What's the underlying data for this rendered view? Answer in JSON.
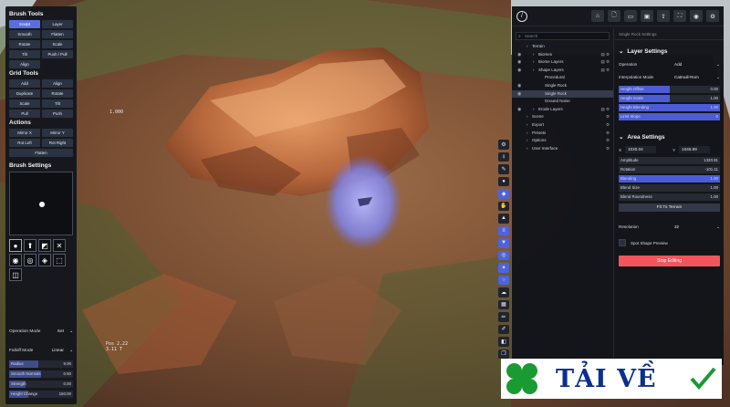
{
  "left_panel": {
    "brush_tools": {
      "title": "Brush Tools",
      "buttons": [
        "Sculpt",
        "Layer",
        "Smooth",
        "Flatten",
        "Rotate",
        "Scale",
        "Tilt",
        "Push / Pull",
        "Align"
      ]
    },
    "grid_tools": {
      "title": "Grid Tools",
      "buttons": [
        "Add",
        "Align",
        "Duplicate",
        "Rotate",
        "Scale",
        "Tilt",
        "Pull",
        "Push"
      ]
    },
    "actions": {
      "title": "Actions",
      "buttons": [
        "Mirror X",
        "Mirror Y",
        "Rot Left",
        "Rot Right",
        "Flatten"
      ]
    },
    "brush_settings": {
      "title": "Brush Settings",
      "brush_icons": [
        "●",
        "⬆",
        "◩",
        "✕",
        "◉",
        "◎",
        "◈",
        "⬚",
        "◫"
      ],
      "operation_mode": {
        "label": "Operation Mode",
        "value": "Set"
      },
      "falloff_mode": {
        "label": "Falloff Mode",
        "value": "Linear"
      },
      "sliders": [
        {
          "label": "Radius",
          "value": "9.00",
          "level": 0.45
        },
        {
          "label": "Smooth Normals",
          "value": "0.50",
          "level": 0.5
        },
        {
          "label": "Strength",
          "value": "0.00",
          "level": 0.25
        },
        {
          "label": "Height Change",
          "value": "150.00",
          "level": 0.3
        }
      ]
    }
  },
  "viewport": {
    "scale_label": "1.000",
    "coords_label": "Pos 2.22\n3.11 T"
  },
  "right_panel": {
    "topbar_icons": [
      "home-icon",
      "new-file-icon",
      "open-folder-icon",
      "save-icon",
      "export-icon",
      "fullscreen-icon",
      "camera-icon",
      "settings-icon"
    ],
    "search_placeholder": "Search",
    "tree": [
      {
        "label": "Terrain",
        "indent": 0,
        "eye": false,
        "selected": false
      },
      {
        "label": "Biomes",
        "indent": 1,
        "eye": true,
        "selected": false
      },
      {
        "label": "Biome Layers",
        "indent": 1,
        "eye": true,
        "selected": false
      },
      {
        "label": "Shape Layers",
        "indent": 1,
        "eye": true,
        "selected": false
      },
      {
        "label": "Procedural",
        "indent": 2,
        "eye": false,
        "selected": false
      },
      {
        "label": "Single Rock",
        "indent": 2,
        "eye": true,
        "selected": false
      },
      {
        "label": "Single Rock",
        "indent": 2,
        "eye": true,
        "selected": true
      },
      {
        "label": "Ground Noise",
        "indent": 2,
        "eye": false,
        "selected": false
      },
      {
        "label": "Erode Layers",
        "indent": 1,
        "eye": true,
        "selected": false
      },
      {
        "label": "Scene",
        "indent": 0,
        "eye": false,
        "selected": false
      },
      {
        "label": "Export",
        "indent": 0,
        "eye": false,
        "selected": false
      },
      {
        "label": "Presets",
        "indent": 0,
        "eye": false,
        "selected": false
      },
      {
        "label": "Options",
        "indent": 0,
        "eye": false,
        "selected": false
      },
      {
        "label": "User Interface",
        "indent": 0,
        "eye": false,
        "selected": false
      }
    ],
    "props_title": "Single Rock Settings",
    "layer_settings": {
      "title": "Layer Settings",
      "operation": {
        "label": "Operation",
        "value": "Add"
      },
      "interpolation": {
        "label": "Interpolation Mode",
        "value": "Catmull-Rom"
      },
      "bars": [
        {
          "label": "Height Offset",
          "value": "0.00",
          "level": 0.5
        },
        {
          "label": "Height Scale",
          "value": "1.00",
          "level": 0.5
        },
        {
          "label": "Height Blending",
          "value": "1.00",
          "level": 1.0
        },
        {
          "label": "Limit Slope",
          "value": "0",
          "level": 1.0
        }
      ]
    },
    "area_settings": {
      "title": "Area Settings",
      "x_label": "X",
      "x_value": "1020.04",
      "y_label": "Y",
      "y_value": "1046.99",
      "bars": [
        {
          "label": "Amplitude",
          "value": "1320.91",
          "level": 0.0
        },
        {
          "label": "Rotation",
          "value": "-101.11",
          "level": 0.0
        },
        {
          "label": "Blending",
          "value": "1.00",
          "level": 1.0
        },
        {
          "label": "Blend Size",
          "value": "1.00",
          "level": 0.0
        },
        {
          "label": "Blend Roundness",
          "value": "1.00",
          "level": 0.0
        }
      ],
      "fit_button": "Fit To Terrain",
      "resolution": {
        "label": "Resolution",
        "value": "32"
      },
      "preview_checkbox": "Spot Shape Preview",
      "stop_button": "Stop Editing"
    }
  },
  "watermark": {
    "text": "TẢI VỀ"
  },
  "colors": {
    "accent": "#4c5cd6",
    "stop": "#f0565c",
    "panel": "#14161c"
  }
}
